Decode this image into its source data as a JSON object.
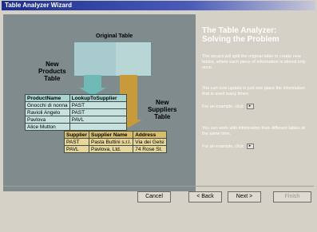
{
  "window": {
    "title": "Table Analyzer Wizard"
  },
  "illustration": {
    "original_table_label": "Original Table",
    "new_products_label_lines": [
      "New",
      "Products",
      "Table"
    ],
    "new_suppliers_label_lines": [
      "New",
      "Suppliers",
      "Table"
    ],
    "products_table": {
      "headers": [
        "ProductName",
        "LookupToSupplier"
      ],
      "rows": [
        [
          "Gnocchi di nonna",
          "PAST"
        ],
        [
          "Ravioli Angelo",
          "PAST"
        ],
        [
          "Pavlova",
          "PAVL"
        ],
        [
          "Alice Mutton",
          ""
        ]
      ]
    },
    "suppliers_table": {
      "headers": [
        "Supplier",
        "Supplier Name",
        "Address"
      ],
      "rows": [
        [
          "PAST",
          "Pasta Buttini s.r.l.",
          "Via dei Gelsi"
        ],
        [
          "PAVL",
          "Pavlova, Ltd.",
          "74 Rose St."
        ]
      ]
    }
  },
  "panel": {
    "title_lines": [
      "The Table Analyzer:",
      "Solving the Problem"
    ],
    "para1": "The wizard will split the original table to create new tables, where each piece of information is stored only once.",
    "para2": "You can now update in just one place the information that is used many times.",
    "example1": "For an example, click",
    "para3": "You can work with information from different tables at the same time.",
    "example2": "For an example, click"
  },
  "buttons": {
    "cancel": "Cancel",
    "back": "< Back",
    "next": "Next >",
    "finish": "Finish"
  }
}
